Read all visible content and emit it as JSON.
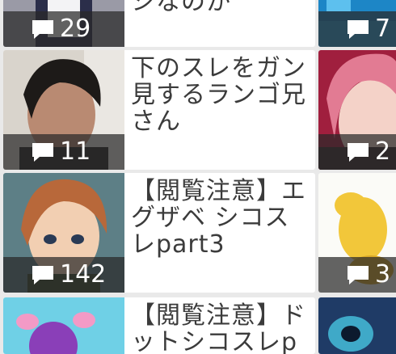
{
  "threads": [
    {
      "title": "シなのか",
      "comments": "29"
    },
    {
      "title": "下のスレをガン見するランゴ兄さん",
      "comments": "11"
    },
    {
      "title": "【閲覧注意】エグザベ シコスレpart3",
      "comments": "142"
    },
    {
      "title": "【閲覧注意】ドットシコスレp",
      "comments": ""
    }
  ],
  "right_column": [
    {
      "comments": "7"
    },
    {
      "comments": "2"
    },
    {
      "comments": "3"
    },
    {
      "comments": ""
    }
  ],
  "colors": {
    "background": "#e9e9e9",
    "card": "#ffffff",
    "text": "#3b3b3b",
    "overlay": "rgba(40,40,40,0.72)"
  }
}
